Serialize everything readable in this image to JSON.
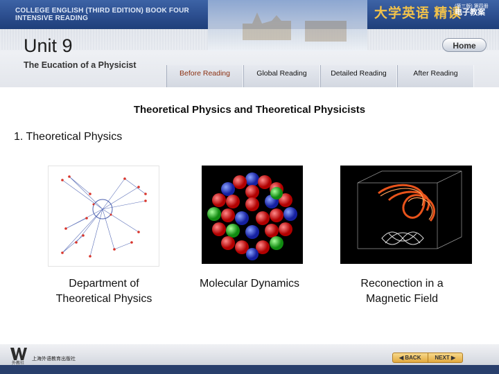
{
  "header": {
    "course": "COLLEGE ENGLISH (THIRD EDITION) BOOK FOUR\nINTENSIVE READING",
    "brand": "大学英语 精读",
    "edition_small": "(第三版) 第四册",
    "edition_big": "电子教案",
    "unit": "Unit 9",
    "subtitle": "The Eucation of a Physicist",
    "home_label": "Home"
  },
  "tabs": [
    {
      "label": "Before Reading",
      "active": true
    },
    {
      "label": "Global Reading",
      "active": false
    },
    {
      "label": "Detailed Reading",
      "active": false
    },
    {
      "label": "After Reading",
      "active": false
    }
  ],
  "main": {
    "title": "Theoretical Physics and Theoretical Physicists",
    "section": "1. Theoretical Physics",
    "figures": [
      {
        "caption": " Department of\nTheoretical Physics"
      },
      {
        "caption": "Molecular Dynamics"
      },
      {
        "caption": " Reconection in a\nMagnetic Field"
      }
    ]
  },
  "footer": {
    "logo_text": "外教社",
    "publisher": "上海外语教育出版社",
    "back_label": "BACK",
    "next_label": "NEXT"
  },
  "colors": {
    "header_bar": "#2a4c8c",
    "brand_gold": "#f2c24a",
    "active_tab": "#8a2f10",
    "footer_bar": "#293f6c",
    "nav_button": "#e2a93e"
  }
}
